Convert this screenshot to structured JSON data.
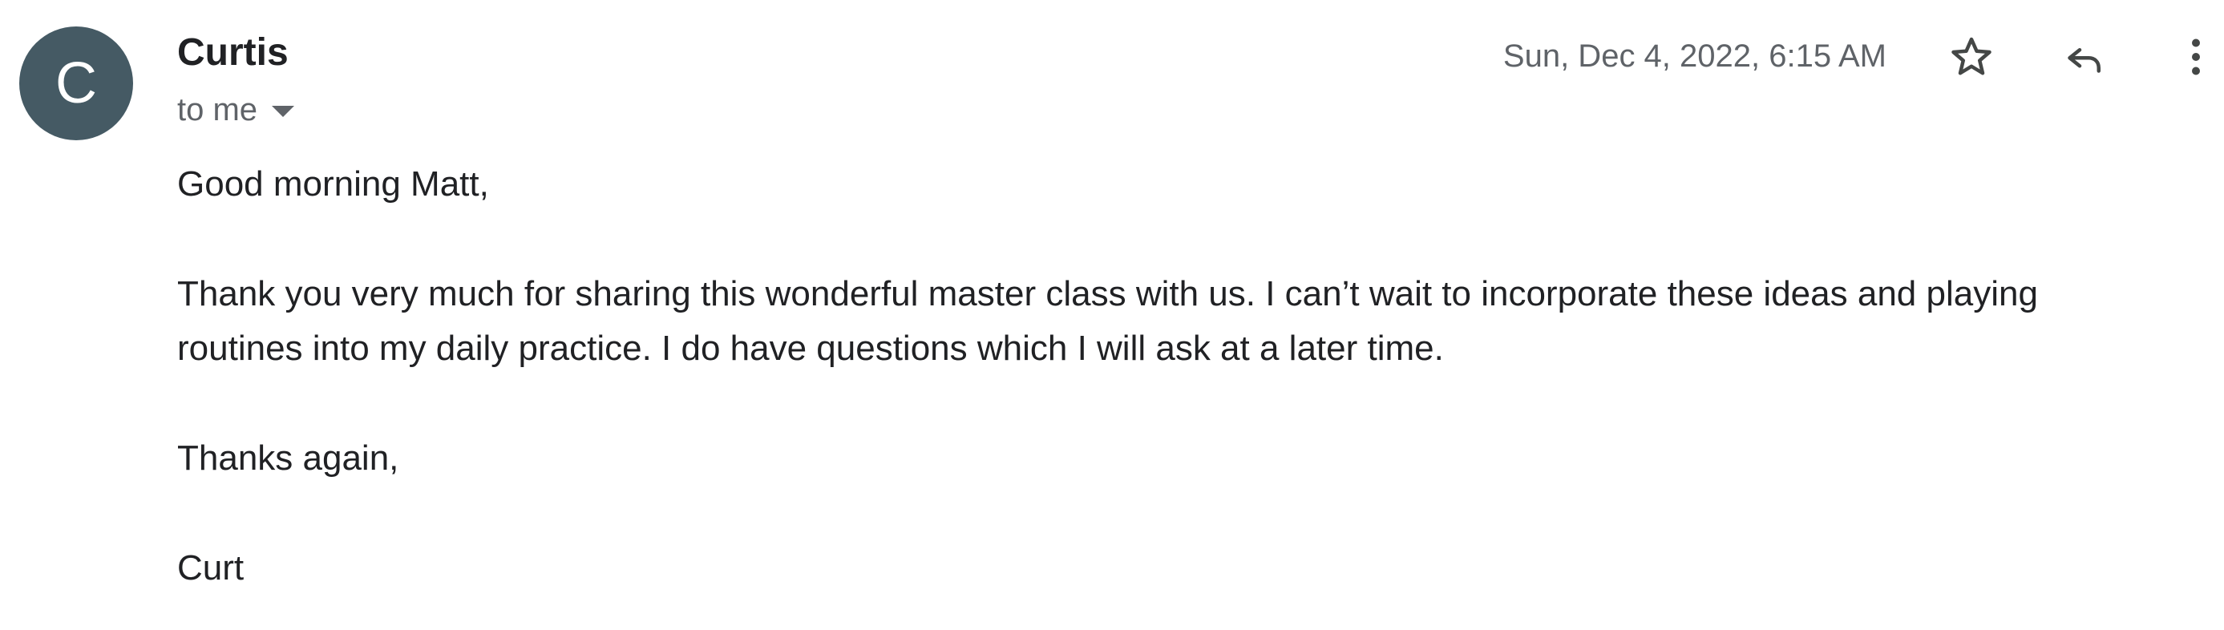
{
  "email": {
    "sender": {
      "avatar_letter": "C",
      "avatar_color": "#455a64",
      "name": "Curtis"
    },
    "recipients_label": "to me",
    "date": "Sun, Dec 4, 2022, 6:15 AM",
    "actions": {
      "star_icon": "star-outline-icon",
      "reply_icon": "reply-icon",
      "more_icon": "more-vert-icon"
    },
    "body": {
      "greeting": "Good morning Matt,",
      "paragraph": "Thank you very much for sharing this wonderful master class with us. I can’t wait to incorporate these ideas and playing routines into my daily practice. I do have questions which I will ask at a later time.",
      "closing": "Thanks again,",
      "signature": "Curt"
    }
  }
}
